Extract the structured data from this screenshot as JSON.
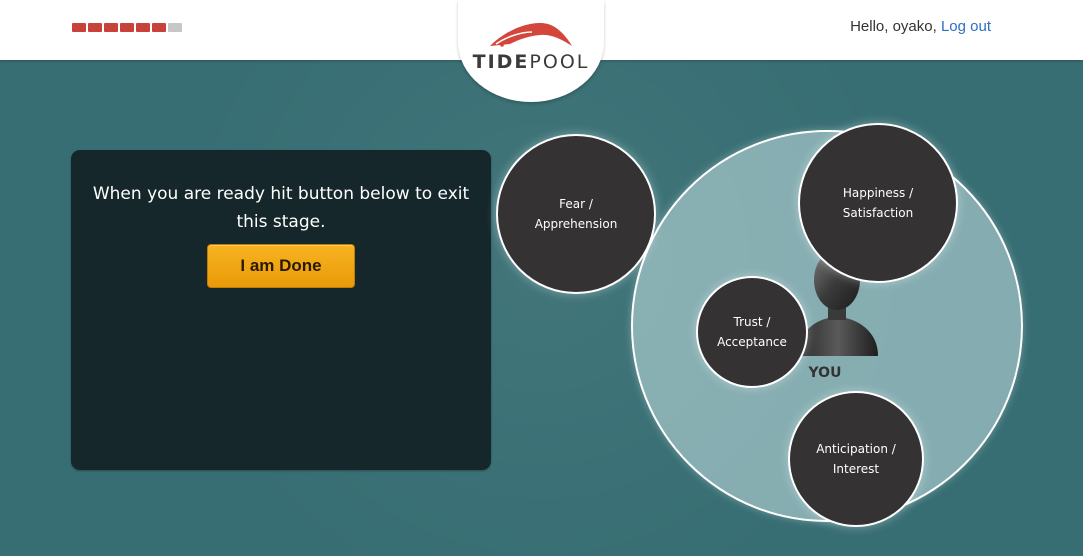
{
  "header": {
    "progress": {
      "total_segments": 7,
      "filled_segments": 6,
      "filled_color": "#c8413b",
      "empty_color": "#c7c7c7"
    },
    "logo": {
      "text_bold": "TIDE",
      "text_light": "POOL",
      "mark_color": "#d2463c"
    },
    "greeting_prefix": "Hello, oyako,",
    "logout_label": "Log out"
  },
  "panel": {
    "message": "When you are ready hit button below to exit this stage.",
    "done_button_label": "I am Done"
  },
  "board": {
    "you_label": "YOU",
    "circles": [
      {
        "id": "fear",
        "line1": "Fear /",
        "line2": "Apprehension"
      },
      {
        "id": "happiness",
        "line1": "Happiness /",
        "line2": "Satisfaction"
      },
      {
        "id": "trust",
        "line1": "Trust /",
        "line2": "Acceptance"
      },
      {
        "id": "anticipation",
        "line1": "Anticipation /",
        "line2": "Interest"
      }
    ]
  },
  "colors": {
    "background": "#376e73",
    "panel": "#16272c",
    "button": "#f0a413",
    "circle_fill": "#343233",
    "link": "#2e6fc2"
  }
}
